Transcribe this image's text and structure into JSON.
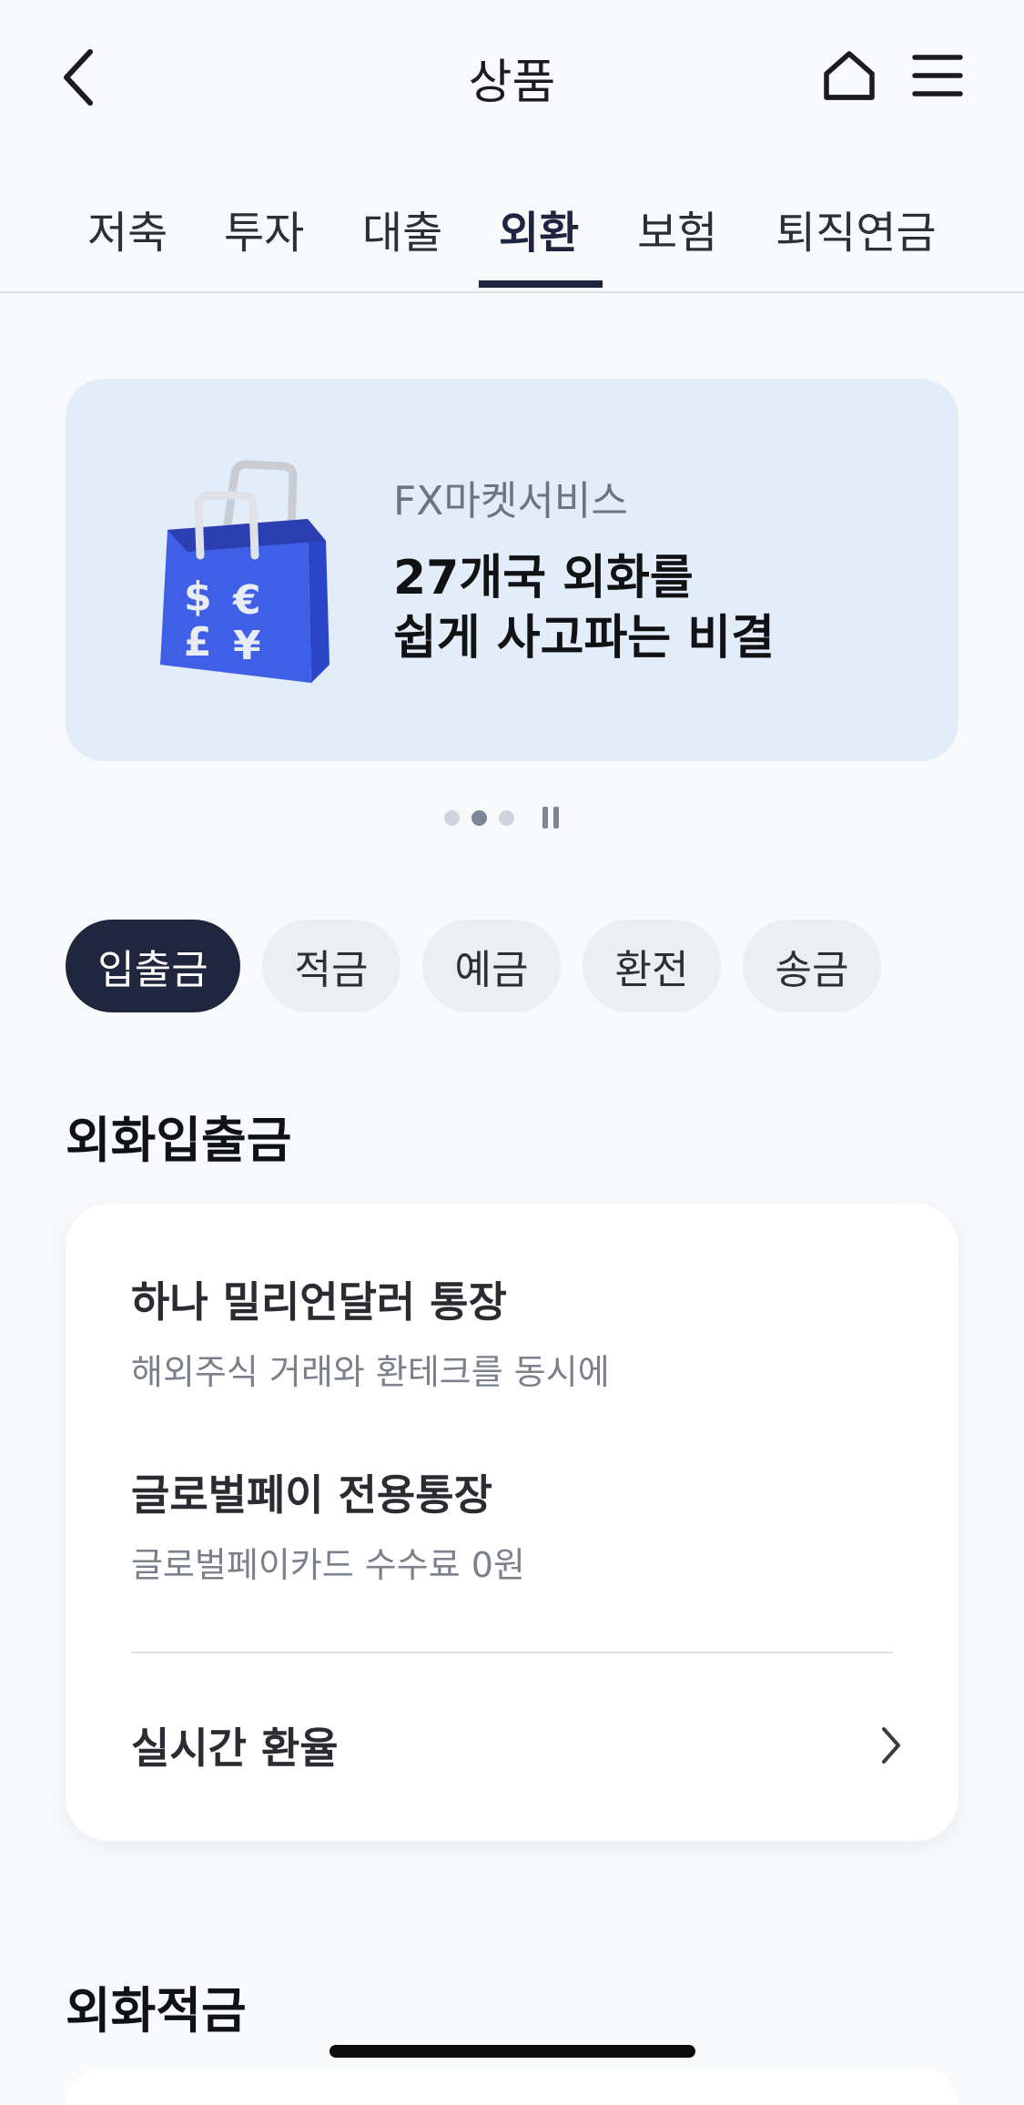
{
  "header": {
    "title": "상품",
    "back_icon": "chevron-left-icon",
    "home_icon": "home-icon",
    "menu_icon": "hamburger-menu-icon"
  },
  "tabs": [
    {
      "label": "저축",
      "active": false
    },
    {
      "label": "투자",
      "active": false
    },
    {
      "label": "대출",
      "active": false
    },
    {
      "label": "외환",
      "active": true
    },
    {
      "label": "보험",
      "active": false
    },
    {
      "label": "퇴직연금",
      "active": false
    }
  ],
  "banner": {
    "kicker": "FX마켓서비스",
    "headline": "27개국 외화를\n쉽게 사고파는 비결",
    "illustration": "shopping-bag-currency-icon",
    "currency_symbols": [
      "$",
      "€",
      "£",
      "¥"
    ],
    "carousel": {
      "total": 3,
      "active_index": 1,
      "control_icon": "pause-icon"
    }
  },
  "chips": [
    {
      "label": "입출금",
      "active": true
    },
    {
      "label": "적금",
      "active": false
    },
    {
      "label": "예금",
      "active": false
    },
    {
      "label": "환전",
      "active": false
    },
    {
      "label": "송금",
      "active": false
    }
  ],
  "deposit_section": {
    "title": "외화입출금",
    "items": [
      {
        "title": "하나 밀리언달러 통장",
        "subtitle": "해외주식 거래와 환테크를 동시에"
      },
      {
        "title": "글로벌페이 전용통장",
        "subtitle": "글로벌페이카드 수수료 0원"
      }
    ],
    "link": {
      "label": "실시간 환율",
      "icon": "chevron-right-icon"
    }
  },
  "savings_section": {
    "title": "외화적금"
  },
  "colors": {
    "background": "#f7f9fb",
    "accent_navy": "#21263f",
    "banner_bg": "#e3ecf9",
    "bag_blue": "#3f5fe6",
    "chip_bg": "#eceef2"
  }
}
